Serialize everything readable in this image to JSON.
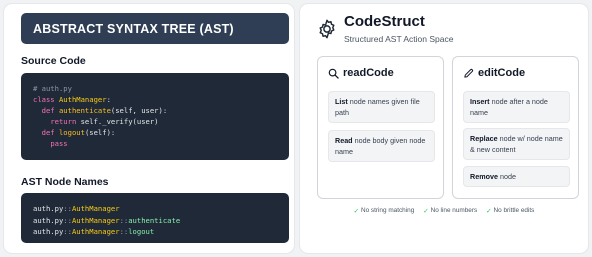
{
  "left": {
    "banner": "ABSTRACT SYNTAX TREE (AST)",
    "source_title": "Source Code",
    "source_lines": {
      "l1": "# auth.py",
      "l2_kw": "class",
      "l2_name": "AuthManager",
      "l2_end": ":",
      "l3_kw": "def",
      "l3_name": "authenticate",
      "l3_end": "(self, user):",
      "l4_kw": "return",
      "l4_end": " self._verify(user)",
      "l5_kw": "def",
      "l5_name": "logout",
      "l5_end": "(self):",
      "l6_kw": "pass"
    },
    "nodes_title": "AST Node Names",
    "nodes": [
      {
        "file": "auth.py",
        "sep": "::",
        "cls": "AuthManager",
        "sep2": "",
        "method": ""
      },
      {
        "file": "auth.py",
        "sep": "::",
        "cls": "AuthManager",
        "sep2": "::",
        "method": "authenticate"
      },
      {
        "file": "auth.py",
        "sep": "::",
        "cls": "AuthManager",
        "sep2": "::",
        "method": "logout"
      }
    ]
  },
  "right": {
    "title": "CodeStruct",
    "subtitle": "Structured AST Action Space",
    "icon": "gear-icon",
    "read": {
      "title": "readCode",
      "icon": "search-icon",
      "ops": [
        {
          "bold": "List",
          "rest": " node names given file path"
        },
        {
          "bold": "Read",
          "rest": " node body given node name"
        }
      ]
    },
    "edit": {
      "title": "editCode",
      "icon": "pencil-icon",
      "ops": [
        {
          "bold": "Insert",
          "rest": " node after a node name"
        },
        {
          "bold": "Replace",
          "rest": " node w/ node name & new content"
        },
        {
          "bold": "Remove",
          "rest": " node"
        }
      ]
    },
    "footer": [
      {
        "mark": "✓",
        "text": "No string matching"
      },
      {
        "mark": "✓",
        "text": "No line numbers"
      },
      {
        "mark": "✓",
        "text": "No brittle edits"
      }
    ]
  },
  "colors": {
    "banner_bg": "#2f3e54",
    "code_bg": "#1f2937",
    "keyword": "#f472b6",
    "class_name": "#facc15",
    "method": "#86efac",
    "check": "#22c55e"
  }
}
